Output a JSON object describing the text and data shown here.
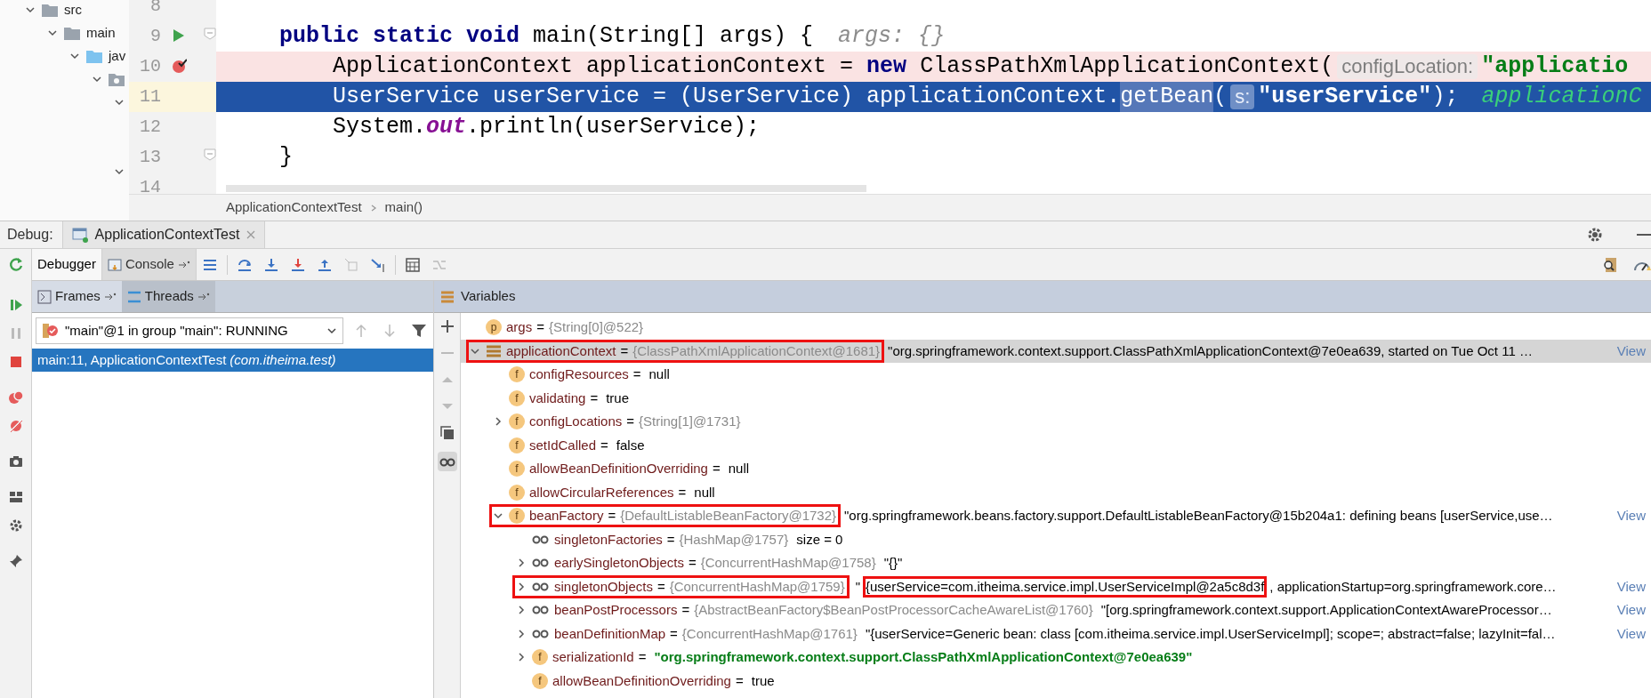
{
  "project_tree": [
    {
      "label": "src",
      "expanded": true,
      "children": [
        {
          "label": "main",
          "expanded": true,
          "children": [
            {
              "label": "jav",
              "expanded": true,
              "children": [
                {
                  "expanded": true,
                  "children": [
                    {
                      "expanded": true
                    },
                    {
                      "expanded": true
                    }
                  ]
                }
              ]
            }
          ]
        }
      ]
    }
  ],
  "editor": {
    "lines": [
      {
        "number": "8",
        "kind": "normal",
        "run_marker": false,
        "fold": false
      },
      {
        "number": "9",
        "kind": "normal",
        "run_marker": true,
        "fold": true,
        "indented": false,
        "tokens": [
          {
            "text": "public static void",
            "kind": "keyword"
          },
          {
            "text": " main(String[] args) {",
            "kind": "plain"
          },
          {
            "text": "args: {}",
            "kind": "hint"
          }
        ]
      },
      {
        "number": "10",
        "kind": "breakpoint",
        "run_marker": false,
        "fold": false,
        "indented": true,
        "tokens": [
          {
            "text": "ApplicationContext applicationContext = ",
            "kind": "plain"
          },
          {
            "text": "new",
            "kind": "keyword"
          },
          {
            "text": " ClassPathXmlApplicationContext(",
            "kind": "plain"
          },
          {
            "text": "configLocation:",
            "kind": "inlay"
          },
          {
            "text": "\"applicatio",
            "kind": "string"
          }
        ]
      },
      {
        "number": "11",
        "kind": "current",
        "run_marker": false,
        "fold": false,
        "indented": true,
        "tokens": [
          {
            "text": "UserService userService = (UserService) applicationContext.",
            "kind": "plain"
          },
          {
            "text": "getBean",
            "kind": "usage"
          },
          {
            "text": "(",
            "kind": "plain"
          },
          {
            "text": "s:",
            "kind": "inlay"
          },
          {
            "text": "\"userService\"",
            "kind": "string"
          },
          {
            "text": ");",
            "kind": "plain"
          },
          {
            "text": "applicationC",
            "kind": "value_hint"
          }
        ]
      },
      {
        "number": "12",
        "kind": "normal",
        "run_marker": false,
        "fold": false,
        "indented": true,
        "tokens": [
          {
            "text": "System.",
            "kind": "plain"
          },
          {
            "text": "out",
            "kind": "static"
          },
          {
            "text": ".println(userService);",
            "kind": "plain"
          }
        ]
      },
      {
        "number": "13",
        "kind": "normal",
        "run_marker": false,
        "fold": true,
        "indented": false,
        "tokens": [
          {
            "text": "}",
            "kind": "plain"
          }
        ]
      },
      {
        "number": "14",
        "kind": "normal",
        "run_marker": false,
        "fold": false
      }
    ],
    "breadcrumb": [
      "ApplicationContextTest",
      "main()"
    ]
  },
  "debug": {
    "title": "Debug:",
    "session_tab": "ApplicationContextTest",
    "tabs": [
      {
        "label": "Debugger",
        "selected": true
      },
      {
        "label": "Console",
        "selected": false
      }
    ],
    "layout_buttons": [
      "Frames",
      "Threads"
    ],
    "thread_selector": "\"main\"@1 in group \"main\": RUNNING",
    "frames": [
      {
        "location": "main:11, ApplicationContextTest",
        "package": "(com.itheima.test)",
        "selected": true
      }
    ],
    "variables_title": "Variables",
    "variables": [
      {
        "name": "args",
        "operator": "=",
        "kind": "letter",
        "badge": "p",
        "type": "{String[0]@522}",
        "selected": false,
        "boxed": false
      },
      {
        "name": "applicationContext",
        "operator": "=",
        "kind": "object",
        "expanded": true,
        "type": "{ClassPathXmlApplicationContext@1681}",
        "value": "\"org.springframework.context.support.ClassPathXmlApplicationContext@7e0ea639, started on Tue Oct 11 …",
        "view_link": "View",
        "selected": true,
        "boxed": true,
        "children": [
          {
            "name": "configResources",
            "operator": "=",
            "kind": "letter",
            "badge": "f",
            "value": "null",
            "selected": false,
            "boxed": false
          },
          {
            "name": "validating",
            "operator": "=",
            "kind": "letter",
            "badge": "f",
            "value": "true",
            "selected": false,
            "boxed": false
          },
          {
            "name": "configLocations",
            "operator": "=",
            "kind": "letter",
            "badge": "f",
            "expanded": false,
            "type": "{String[1]@1731}",
            "selected": false,
            "boxed": false
          },
          {
            "name": "setIdCalled",
            "operator": "=",
            "kind": "letter",
            "badge": "f",
            "value": "false",
            "selected": false,
            "boxed": false
          },
          {
            "name": "allowBeanDefinitionOverriding",
            "operator": "=",
            "kind": "letter",
            "badge": "f",
            "value": "null",
            "selected": false,
            "boxed": false
          },
          {
            "name": "allowCircularReferences",
            "operator": "=",
            "kind": "letter",
            "badge": "f",
            "value": "null",
            "selected": false,
            "boxed": false
          },
          {
            "name": "beanFactory",
            "operator": "=",
            "kind": "letter",
            "badge": "f",
            "expanded": true,
            "type": "{DefaultListableBeanFactory@1732}",
            "value": "\"org.springframework.beans.factory.support.DefaultListableBeanFactory@15b204a1: defining beans [userService,use…",
            "view_link": "View",
            "selected": false,
            "boxed": true,
            "children": [
              {
                "name": "singletonFactories",
                "operator": "=",
                "kind": "watch",
                "type": "{HashMap@1757}",
                "value": "size = 0",
                "selected": false,
                "boxed": false
              },
              {
                "name": "earlySingletonObjects",
                "operator": "=",
                "kind": "watch",
                "expanded": false,
                "type": "{ConcurrentHashMap@1758}",
                "value": "\"{}\"",
                "selected": false,
                "boxed": false
              },
              {
                "name": "singletonObjects",
                "operator": "=",
                "kind": "watch",
                "expanded": false,
                "type": "{ConcurrentHashMap@1759}",
                "value_parts": [
                  {
                    "text": "\"",
                    "boxed": false
                  },
                  {
                    "text": "{userService=com.itheima.service.impl.UserServiceImpl@2a5c8d3f",
                    "boxed": true
                  },
                  {
                    "text": ", applicationStartup=org.springframework.core…",
                    "boxed": false
                  }
                ],
                "view_link": "View",
                "selected": false,
                "boxed": true
              },
              {
                "name": "beanPostProcessors",
                "operator": "=",
                "kind": "watch",
                "expanded": false,
                "type": "{AbstractBeanFactory$BeanPostProcessorCacheAwareList@1760}",
                "value": "\"[org.springframework.context.support.ApplicationContextAwareProcessor…",
                "view_link": "View",
                "selected": false,
                "boxed": false
              },
              {
                "name": "beanDefinitionMap",
                "operator": "=",
                "kind": "watch",
                "expanded": false,
                "type": "{ConcurrentHashMap@1761}",
                "value": "\"{userService=Generic bean: class [com.itheima.service.impl.UserServiceImpl]; scope=; abstract=false; lazyInit=fal…",
                "view_link": "View",
                "selected": false,
                "boxed": false
              },
              {
                "name": "serializationId",
                "operator": "=",
                "kind": "letter",
                "badge": "f",
                "expanded": false,
                "value": "\"org.springframework.context.support.ClassPathXmlApplicationContext@7e0ea639\"",
                "literal": true,
                "selected": false,
                "boxed": false
              },
              {
                "name": "allowBeanDefinitionOverriding",
                "operator": "=",
                "kind": "letter",
                "badge": "f",
                "value": "true",
                "selected": false,
                "boxed": false
              }
            ]
          }
        ]
      }
    ]
  }
}
